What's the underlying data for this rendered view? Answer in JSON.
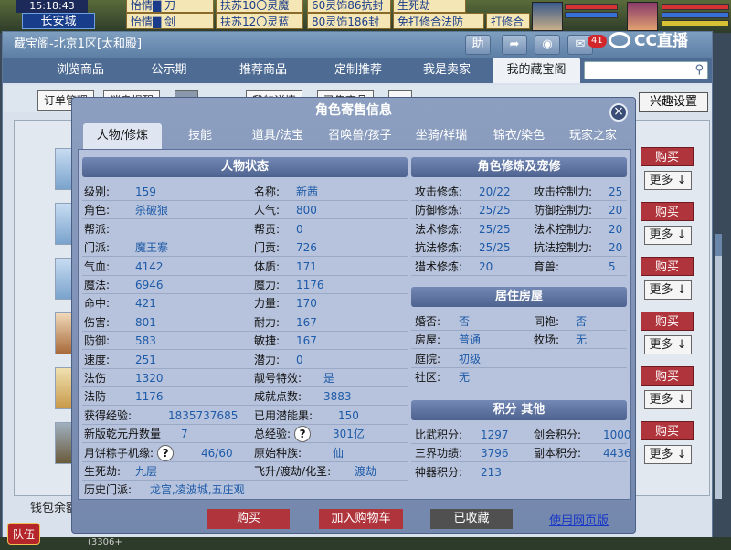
{
  "game": {
    "time": "15:18:43",
    "city": "长安城",
    "chat_lines": [
      "怡情▇ 刀",
      "扶苏10〇灵魔",
      "60灵饰86抗封",
      "生死劫",
      "怡情▇ 剑",
      "扶苏12〇灵蓝",
      "80灵饰186封",
      "免打修合法防",
      "打修合"
    ],
    "team_button": "队伍",
    "bottom_code": "(3306+"
  },
  "watermark": {
    "brand": "CC直播"
  },
  "window": {
    "title": "藏宝阁-北京1区[太和殿]",
    "help_button": "助",
    "message_count": "41",
    "nav_tabs": [
      "浏览商品",
      "公示期",
      "推荐商品",
      "定制推荐",
      "我是卖家",
      "我的藏宝阁"
    ],
    "active_nav": "我的藏宝阁",
    "sub_buttons": [
      "订单管理",
      "消息提醒",
      "…",
      "我的详情",
      "已售商品",
      "…"
    ],
    "interest_button": "兴趣设置",
    "row_buy": "购买",
    "row_more": "更多 ↓",
    "wallet_label": "钱包余额"
  },
  "dialog": {
    "title": "角色寄售信息",
    "tabs": [
      "人物/修炼",
      "技能",
      "道具/法宝",
      "召唤兽/孩子",
      "坐骑/祥瑞",
      "锦衣/染色",
      "玩家之家"
    ],
    "active_tab": "人物/修炼",
    "status_header": "人物状态",
    "status_left": [
      {
        "k": "级别:",
        "v": "159"
      },
      {
        "k": "角色:",
        "v": "杀破狼"
      },
      {
        "k": "帮派:",
        "v": ""
      },
      {
        "k": "门派:",
        "v": "魔王寨"
      },
      {
        "k": "气血:",
        "v": "4142"
      },
      {
        "k": "魔法:",
        "v": "6946"
      },
      {
        "k": "命中:",
        "v": "421"
      },
      {
        "k": "伤害:",
        "v": "801"
      },
      {
        "k": "防御:",
        "v": "583"
      },
      {
        "k": "速度:",
        "v": "251"
      },
      {
        "k": "法伤",
        "v": "1320"
      },
      {
        "k": "法防",
        "v": "1176"
      },
      {
        "k": "获得经验:",
        "v": "1835737685"
      },
      {
        "k": "新版乾元丹数量",
        "v": "7"
      },
      {
        "k": "月饼粽子机缘:",
        "v": "46/60"
      },
      {
        "k": "生死劫:",
        "v": "九层"
      }
    ],
    "status_right": [
      {
        "k": "名称:",
        "v": "新茜"
      },
      {
        "k": "人气:",
        "v": "800"
      },
      {
        "k": "帮贡:",
        "v": "0"
      },
      {
        "k": "门贡:",
        "v": "726"
      },
      {
        "k": "体质:",
        "v": "171"
      },
      {
        "k": "魔力:",
        "v": "1176"
      },
      {
        "k": "力量:",
        "v": "170"
      },
      {
        "k": "耐力:",
        "v": "167"
      },
      {
        "k": "敏捷:",
        "v": "167"
      },
      {
        "k": "潜力:",
        "v": "0"
      },
      {
        "k": "靓号特效:",
        "v": "是"
      },
      {
        "k": "成就点数:",
        "v": "3883"
      },
      {
        "k": "已用潜能果:",
        "v": "150"
      },
      {
        "k": "总经验:",
        "v": "301亿"
      },
      {
        "k": "原始种族:",
        "v": "仙"
      },
      {
        "k": "飞升/渡劫/化圣:",
        "v": "渡劫"
      }
    ],
    "history_label": "历史门派:",
    "history_value": "龙宫,凌波城,五庄观",
    "cult_header": "角色修炼及宠修",
    "cult": [
      {
        "k": "攻击修炼:",
        "v": "20/22",
        "k2": "攻击控制力:",
        "v2": "25"
      },
      {
        "k": "防御修炼:",
        "v": "25/25",
        "k2": "防御控制力:",
        "v2": "20"
      },
      {
        "k": "法术修炼:",
        "v": "25/25",
        "k2": "法术控制力:",
        "v2": "20"
      },
      {
        "k": "抗法修炼:",
        "v": "25/25",
        "k2": "抗法控制力:",
        "v2": "20"
      },
      {
        "k": "猎术修炼:",
        "v": "20",
        "k2": "育兽:",
        "v2": "5"
      }
    ],
    "house_header": "居住房屋",
    "house": [
      {
        "k": "婚否:",
        "v": "否",
        "k2": "同袍:",
        "v2": "否"
      },
      {
        "k": "房屋:",
        "v": "普通",
        "k2": "牧场:",
        "v2": "无"
      },
      {
        "k": "庭院:",
        "v": "初级",
        "k2": "",
        "v2": ""
      },
      {
        "k": "社区:",
        "v": "无",
        "k2": "",
        "v2": ""
      }
    ],
    "score_header": "积分 其他",
    "score": [
      {
        "k": "比武积分:",
        "v": "1297",
        "k2": "剑会积分:",
        "v2": "1000"
      },
      {
        "k": "三界功绩:",
        "v": "3796",
        "k2": "副本积分:",
        "v2": "4436"
      },
      {
        "k": "神器积分:",
        "v": "213",
        "k2": "",
        "v2": ""
      }
    ],
    "buy_button": "购买",
    "cart_button": "加入购物车",
    "fav_button": "已收藏",
    "web_link": "使用网页版",
    "question_mark": "?"
  },
  "colors": {
    "buy_red": "#b0343c",
    "fav_dark": "#505050",
    "value_blue": "#1d5aa8"
  }
}
